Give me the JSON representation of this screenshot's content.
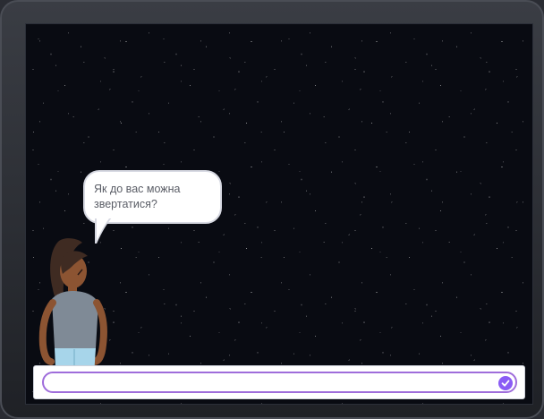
{
  "stage": {
    "question": "Як до вас можна звертатися?"
  },
  "answer": {
    "value": "",
    "placeholder": ""
  },
  "icons": {
    "submit": "checkmark-icon"
  },
  "colors": {
    "accent": "#8a5cf5",
    "input_border": "#9f6ddb",
    "bubble_text": "#5a5d66"
  }
}
